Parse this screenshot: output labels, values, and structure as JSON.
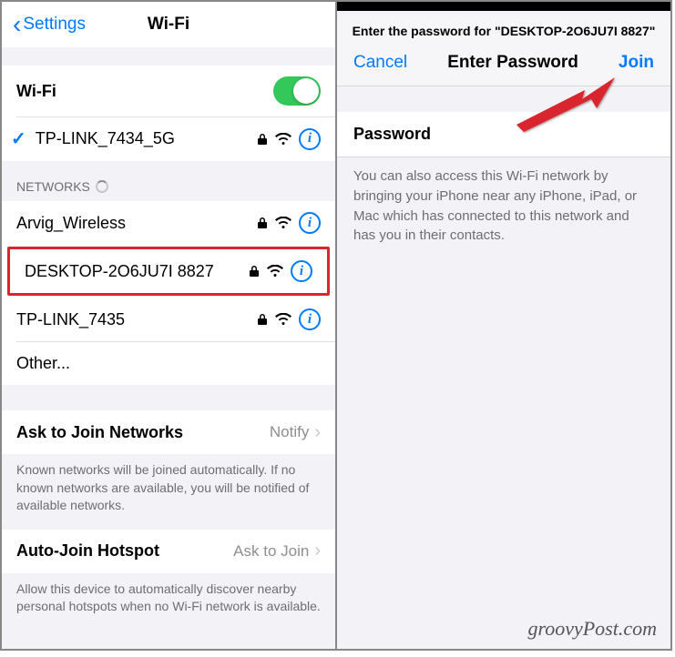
{
  "left": {
    "back_label": "Settings",
    "title": "Wi-Fi",
    "wifi_toggle_label": "Wi-Fi",
    "connected_network": "TP-LINK_7434_5G",
    "networks_header": "NETWORKS",
    "networks": [
      {
        "name": "Arvig_Wireless",
        "locked": true,
        "highlighted": false
      },
      {
        "name": "DESKTOP-2O6JU7I 8827",
        "locked": true,
        "highlighted": true
      },
      {
        "name": "TP-LINK_7435",
        "locked": true,
        "highlighted": false
      }
    ],
    "other_label": "Other...",
    "ask_join_label": "Ask to Join Networks",
    "ask_join_value": "Notify",
    "ask_join_footer": "Known networks will be joined automatically. If no known networks are available, you will be notified of available networks.",
    "auto_hotspot_label": "Auto-Join Hotspot",
    "auto_hotspot_value": "Ask to Join",
    "auto_hotspot_footer": "Allow this device to automatically discover nearby personal hotspots when no Wi-Fi network is available."
  },
  "right": {
    "prompt": "Enter the password for \"DESKTOP-2O6JU7I 8827\"",
    "cancel_label": "Cancel",
    "title": "Enter Password",
    "join_label": "Join",
    "password_label": "Password",
    "hint": "You can also access this Wi-Fi network by bringing your iPhone near any iPhone, iPad, or Mac which has connected to this network and has you in their contacts."
  },
  "watermark": "groovyPost.com"
}
